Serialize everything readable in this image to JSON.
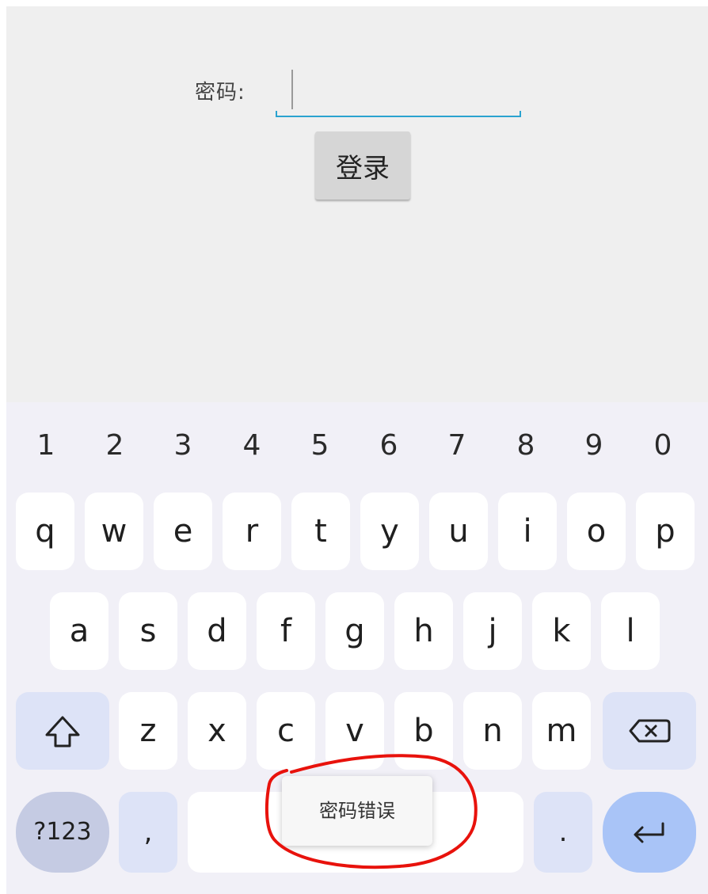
{
  "form": {
    "password_label": "密码:",
    "password_value": "",
    "login_label": "登录"
  },
  "keyboard": {
    "numbers": [
      "1",
      "2",
      "3",
      "4",
      "5",
      "6",
      "7",
      "8",
      "9",
      "0"
    ],
    "row1": [
      "q",
      "w",
      "e",
      "r",
      "t",
      "y",
      "u",
      "i",
      "o",
      "p"
    ],
    "row2": [
      "a",
      "s",
      "d",
      "f",
      "g",
      "h",
      "j",
      "k",
      "l"
    ],
    "row3": [
      "z",
      "x",
      "c",
      "v",
      "b",
      "n",
      "m"
    ],
    "symbols_label": "?123",
    "comma_label": ",",
    "period_label": ".",
    "shift_icon": "shift-icon",
    "backspace_icon": "backspace-icon",
    "enter_icon": "enter-icon"
  },
  "toast": {
    "message": "密码错误"
  },
  "annotation": {
    "color": "#e8120c"
  },
  "colors": {
    "input_accent": "#2aa3d0",
    "keyboard_bg": "#f1f0f7",
    "enter_key": "#a9c4f7"
  }
}
